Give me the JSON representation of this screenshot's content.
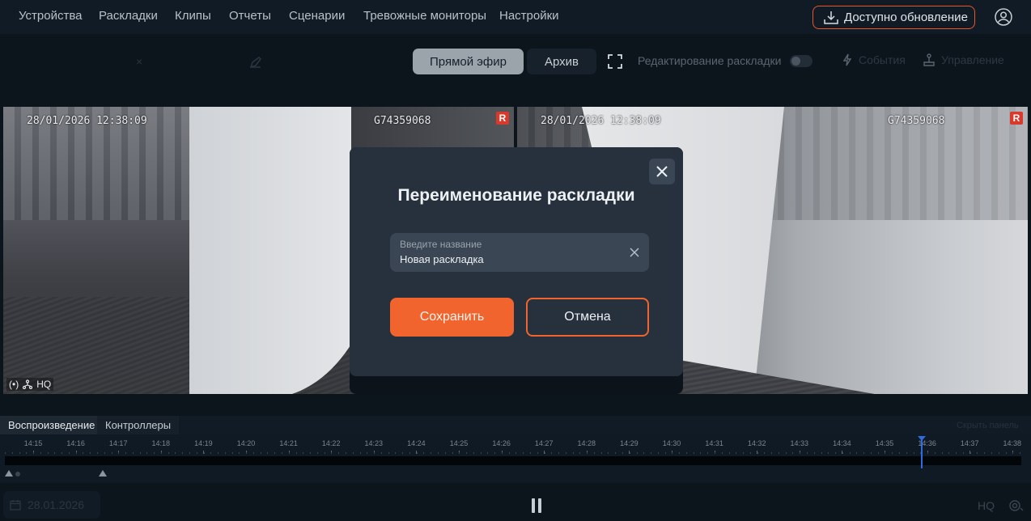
{
  "nav": {
    "items": [
      "Устройства",
      "Раскладки",
      "Клипы",
      "Отчеты",
      "Сценарии",
      "Тревожные мониторы",
      "Настройки"
    ],
    "update_label": "Доступно обновление"
  },
  "toolbar": {
    "live_label": "Прямой эфир",
    "archive_label": "Архив",
    "edit_layout_label": "Редактирование раскладки",
    "events_label": "События",
    "control_label": "Управление"
  },
  "tiles": [
    {
      "timestamp": "28/01/2026 12:38:09",
      "camera_id": "G74359068",
      "rec_badge": "R",
      "quality": "HQ"
    },
    {
      "timestamp": "28/01/2026 12:38:09",
      "camera_id": "G74359068",
      "rec_badge": "R"
    }
  ],
  "modal": {
    "title": "Переименование раскладки",
    "field_label": "Введите название",
    "field_value": "Новая раскладка",
    "save_label": "Сохранить",
    "cancel_label": "Отмена"
  },
  "bottom": {
    "tab_playback": "Воспроизведение",
    "tab_controllers": "Контроллеры",
    "hide_label": "Скрыть панель",
    "date": "28.01.2026",
    "quality": "HQ"
  },
  "timeline": {
    "labels": [
      "14:15",
      "14:16",
      "14:17",
      "14:18",
      "14:19",
      "14:20",
      "14:21",
      "14:22",
      "14:23",
      "14:24",
      "14:25",
      "14:26",
      "14:27",
      "14:28",
      "14:29",
      "14:30",
      "14:31",
      "14:32",
      "14:33",
      "14:34",
      "14:35",
      "14:36",
      "14:37",
      "14:38"
    ]
  },
  "colors": {
    "accent": "#f2642e",
    "cursor": "#2e6be0",
    "recording": "#d9392b"
  }
}
